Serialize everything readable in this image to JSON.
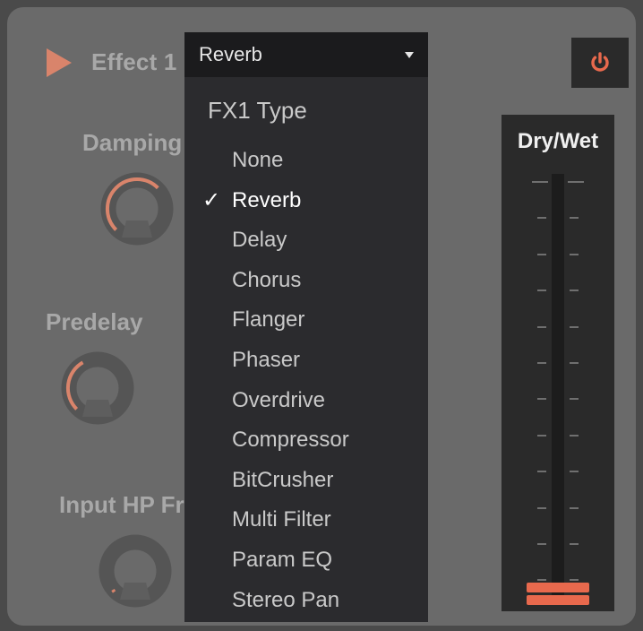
{
  "effect": {
    "label": "Effect 1",
    "type_value": "Reverb"
  },
  "knobs": [
    {
      "label": "Damping"
    },
    {
      "label": "Predelay"
    },
    {
      "label": "Input HP Fre"
    }
  ],
  "dropdown": {
    "title": "FX1 Type",
    "check_mark": "✓",
    "items": [
      {
        "label": "None",
        "selected": false
      },
      {
        "label": "Reverb",
        "selected": true
      },
      {
        "label": "Delay",
        "selected": false
      },
      {
        "label": "Chorus",
        "selected": false
      },
      {
        "label": "Flanger",
        "selected": false
      },
      {
        "label": "Phaser",
        "selected": false
      },
      {
        "label": "Overdrive",
        "selected": false
      },
      {
        "label": "Compressor",
        "selected": false
      },
      {
        "label": "BitCrusher",
        "selected": false
      },
      {
        "label": "Multi Filter",
        "selected": false
      },
      {
        "label": "Param EQ",
        "selected": false
      },
      {
        "label": "Stereo Pan",
        "selected": false
      }
    ]
  },
  "drywet": {
    "label": "Dry/Wet",
    "value": 0.0
  },
  "icons": {
    "play": "play-icon",
    "power": "power-icon",
    "dropdown": "chevron-down-icon"
  },
  "colors": {
    "accent": "#e8694d",
    "panel": "#6a6a6a",
    "dark": "#2a2a2a"
  }
}
